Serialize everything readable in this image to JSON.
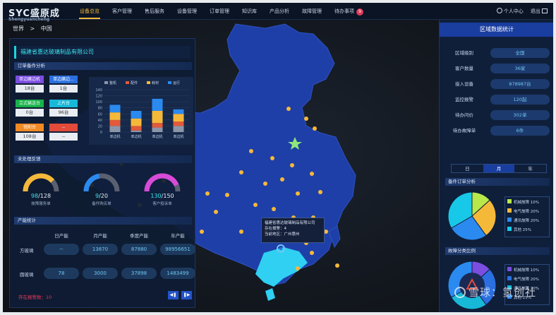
{
  "app": {
    "logo": "SYC盛原成",
    "logo_sub": "Shengyuancheng"
  },
  "nav": [
    {
      "label": "设备总览",
      "active": true
    },
    {
      "label": "客户管理"
    },
    {
      "label": "售后服务"
    },
    {
      "label": "设备管理"
    },
    {
      "label": "订单管理"
    },
    {
      "label": "知识库"
    },
    {
      "label": "产品分析"
    },
    {
      "label": "故障管理"
    },
    {
      "label": "待办事项",
      "badge": "9"
    }
  ],
  "top_right": {
    "user": "个人中心",
    "logout": "退出"
  },
  "breadcrumb": [
    "世界",
    ">",
    "中国"
  ],
  "company": "福建省惠达玻璃制品有限公司",
  "order_section": {
    "title": "订单备件分析",
    "devices": [
      {
        "label": "单边磨边机",
        "value": "18台",
        "color": "#7b4de0"
      },
      {
        "label": "单边磨边...",
        "value": "1台",
        "color": "#2b6fe0"
      },
      {
        "label": "立式输送台",
        "value": "0台",
        "color": "#18b24a"
      },
      {
        "label": "上片台",
        "value": "96台",
        "color": "#18b8d8"
      },
      {
        "label": "铣削台",
        "value": "108台",
        "color": "#f08a24"
      },
      {
        "label": "--",
        "value": "--",
        "color": "#e24a3a"
      }
    ]
  },
  "chart_data": {
    "type": "bar",
    "stacked": true,
    "categories": [
      "单边机",
      "单边机",
      "单边机",
      "单边机"
    ],
    "series": [
      {
        "name": "整机",
        "color": "#8d96a8",
        "values": [
          20,
          5,
          15,
          20
        ]
      },
      {
        "name": "配件",
        "color": "#e25a3a",
        "values": [
          20,
          15,
          15,
          15
        ]
      },
      {
        "name": "耗材",
        "color": "#f5b93a",
        "values": [
          25,
          25,
          40,
          25
        ]
      },
      {
        "name": "运行",
        "color": "#2b8af0",
        "values": [
          25,
          25,
          40,
          15
        ]
      }
    ],
    "ylim": [
      0,
      140
    ],
    "yticks": [
      0,
      20,
      40,
      60,
      80,
      100,
      120,
      140
    ],
    "legend": "top"
  },
  "fault_section": {
    "title": "未处理反馈",
    "gauges": [
      {
        "value": "98",
        "total": "/128",
        "label": "故障服务单",
        "color": "#f5b93a",
        "ratio": 0.77
      },
      {
        "value": "9",
        "total": "/20",
        "label": "备件购买单",
        "color": "#2b8af0",
        "ratio": 0.45
      },
      {
        "value": "130",
        "total": "/150",
        "label": "客户投诉单",
        "color": "#d84ad8",
        "ratio": 0.87
      }
    ]
  },
  "capacity": {
    "title": "产能统计",
    "headers": [
      "日产能",
      "月产能",
      "季度产能",
      "年产能"
    ],
    "rows": [
      {
        "label": "方玻璃",
        "values": [
          "--",
          "13870",
          "87880",
          "98956651"
        ]
      },
      {
        "label": "圆玻璃",
        "values": [
          "78",
          "3000",
          "37898",
          "1483499"
        ]
      }
    ],
    "alarm": "存在报警数：10"
  },
  "tooltip": {
    "title": "福建省惠达玻璃制品有限公司",
    "line1": "存在报警：4",
    "line2": "当前地区：广州惠州"
  },
  "region": {
    "title": "区域数据统计",
    "rows": [
      {
        "k": "区域级别",
        "v": "全国"
      },
      {
        "k": "客户数量",
        "v": "36家"
      },
      {
        "k": "接入设备",
        "v": "878987台"
      },
      {
        "k": "监控报警",
        "v": "120起"
      },
      {
        "k": "待办问价",
        "v": "302单"
      },
      {
        "k": "待办故障单",
        "v": "6件"
      }
    ],
    "tabs": [
      "日",
      "月",
      "年"
    ],
    "active_tab": 1
  },
  "pie1": {
    "title": "备件订单分析",
    "items": [
      {
        "label": "机械故障 10%",
        "color": "#b8e84a",
        "value": 10
      },
      {
        "label": "电气故障 20%",
        "color": "#f5b93a",
        "value": 20
      },
      {
        "label": "通讯故障 20%",
        "color": "#2b8af0",
        "value": 20
      },
      {
        "label": "其他 25%",
        "color": "#18c8e8",
        "value": 25
      }
    ]
  },
  "pie2": {
    "title": "故障分类比例",
    "items": [
      {
        "label": "机械故障 10%",
        "color": "#7b4de0",
        "value": 10
      },
      {
        "label": "电气故障 20%",
        "color": "#2b6fe0",
        "value": 20
      },
      {
        "label": "通讯故障 20%",
        "color": "#18b8d8",
        "value": 20
      },
      {
        "label": "其他 25%",
        "color": "#2b8af0",
        "value": 25
      }
    ]
  },
  "watermark": "雪球：氢创社"
}
